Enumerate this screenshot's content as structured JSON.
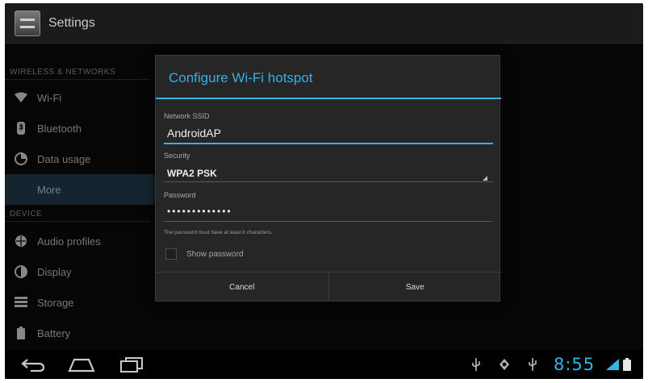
{
  "action_bar": {
    "title": "Settings",
    "icon": "settings-app-icon"
  },
  "settings": {
    "sections": [
      {
        "header": "WIRELESS & NETWORKS"
      },
      {
        "header": "DEVICE"
      }
    ],
    "items": [
      {
        "label": "Wi-Fi",
        "icon": "wifi-icon"
      },
      {
        "label": "Bluetooth",
        "icon": "bluetooth-icon"
      },
      {
        "label": "Data usage",
        "icon": "data-usage-icon"
      },
      {
        "label": "More",
        "selected": true
      },
      {
        "label": "Audio profiles",
        "icon": "audio-profiles-icon"
      },
      {
        "label": "Display",
        "icon": "display-icon"
      },
      {
        "label": "Storage",
        "icon": "storage-icon"
      },
      {
        "label": "Battery",
        "icon": "battery-icon"
      }
    ]
  },
  "dialog": {
    "title": "Configure Wi-Fi hotspot",
    "ssid": {
      "label": "Network SSID",
      "value": "AndroidAP"
    },
    "security": {
      "label": "Security",
      "value": "WPA2 PSK"
    },
    "password": {
      "label": "Password",
      "value": "•••••••••••••",
      "hint": "The password must have at least 8 characters."
    },
    "show_password_label": "Show password",
    "buttons": {
      "cancel": "Cancel",
      "save": "Save"
    }
  },
  "system_bar": {
    "time": "8:55",
    "nav_icons": [
      "back-icon",
      "home-icon",
      "recent-apps-icon"
    ],
    "status_icons": [
      "usb-icon",
      "debug-icon",
      "usb-connection-icon",
      "wifi-signal-icon",
      "battery-status-icon"
    ]
  },
  "colors": {
    "accent": "#33b5e5",
    "background": "#0a0a0a",
    "dialog": "#262626"
  }
}
